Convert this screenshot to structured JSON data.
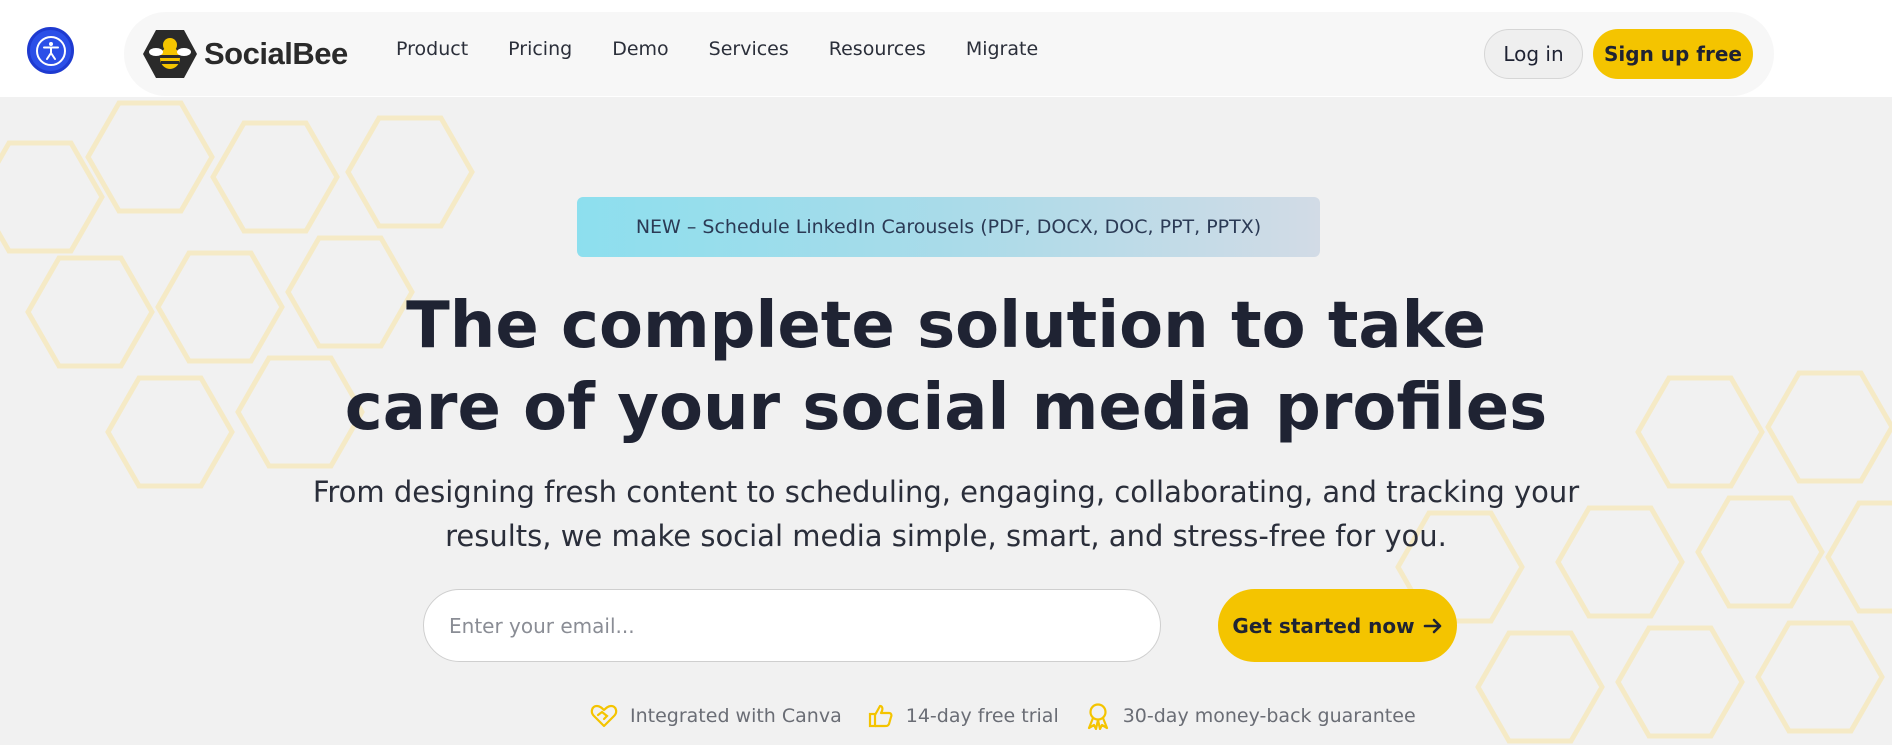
{
  "accessibility": {
    "icon": "accessibility-icon"
  },
  "brand": {
    "name": "SocialBee",
    "logo_icon": "bee-hexagon-icon"
  },
  "nav": {
    "items": [
      {
        "label": "Product"
      },
      {
        "label": "Pricing"
      },
      {
        "label": "Demo"
      },
      {
        "label": "Services"
      },
      {
        "label": "Resources"
      },
      {
        "label": "Migrate"
      }
    ],
    "login_label": "Log in",
    "signup_label": "Sign up free"
  },
  "hero": {
    "banner": "NEW – Schedule LinkedIn Carousels (PDF, DOCX, DOC, PPT, PPTX)",
    "headline_line1": "The complete solution to take",
    "headline_line2": "care of your social media profiles",
    "subtext_line1": "From designing fresh content to scheduling, engaging, collaborating, and tracking your",
    "subtext_line2": "results, we make social media simple, smart, and stress-free for you.",
    "email_placeholder": "Enter your email...",
    "email_value": "",
    "cta_label": "Get started now",
    "cta_icon": "arrow-right-icon"
  },
  "features": [
    {
      "label": "Integrated with Canva",
      "icon": "heart-handshake-icon"
    },
    {
      "label": "14-day free trial",
      "icon": "thumbs-up-icon"
    },
    {
      "label": "30-day money-back guarantee",
      "icon": "award-ribbon-icon"
    }
  ],
  "colors": {
    "accent": "#f4c400",
    "accessibility_blue": "#2b4fe8",
    "text_dark": "#1f2333",
    "background": "#f1f1f1"
  }
}
